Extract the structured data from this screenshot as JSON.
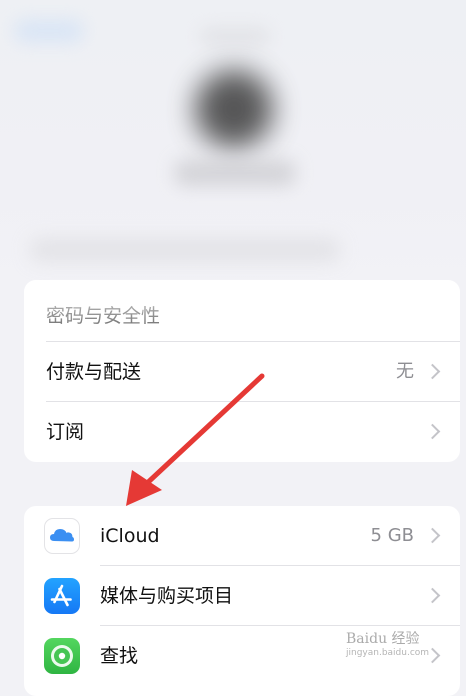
{
  "settings": {
    "group1": {
      "top_row_label": "密码与安全性",
      "payment_label": "付款与配送",
      "payment_value": "无",
      "subscription_label": "订阅"
    },
    "group2": {
      "icloud_label": "iCloud",
      "icloud_value": "5 GB",
      "media_label": "媒体与购买项目",
      "find_label": "查找"
    }
  },
  "annotation": {
    "arrow_color": "#e53935"
  },
  "watermark": {
    "brand": "Baidu 经验",
    "url": "jingyan.baidu.com"
  },
  "icons": [
    "icloud-icon",
    "app-store-icon",
    "find-my-icon",
    "chevron-right-icon"
  ]
}
